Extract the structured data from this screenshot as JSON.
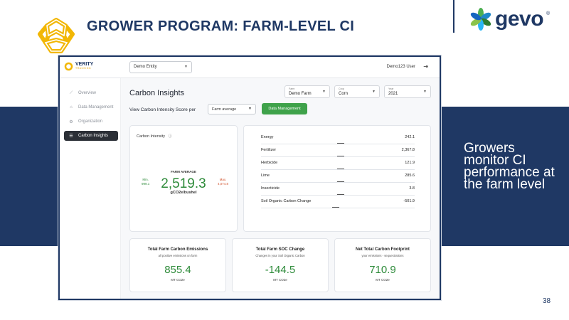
{
  "slide": {
    "title": "GROWER PROGRAM: FARM-LEVEL CI",
    "side_text": "Growers monitor CI performance at the farm level",
    "page_number": "38",
    "logo_word": "gevo",
    "logo_mark": "®"
  },
  "app": {
    "brand": {
      "name": "VERITY",
      "sub": "TRACKING"
    },
    "entity_select": "Demo Entity",
    "user_name": "Demo123 User",
    "sidebar": {
      "items": [
        {
          "label": "Overview",
          "icon": "chart-line-icon"
        },
        {
          "label": "Data Management",
          "icon": "home-icon"
        },
        {
          "label": "Organization",
          "icon": "cog-icon"
        },
        {
          "label": "Carbon Insights",
          "icon": "list-icon",
          "active": true
        }
      ]
    },
    "page_title": "Carbon Insights",
    "filters": [
      {
        "label": "Farm",
        "value": "Demo Farm"
      },
      {
        "label": "Crop",
        "value": "Corn"
      },
      {
        "label": "Year",
        "value": "2021"
      }
    ],
    "ci_score_label": "View Carbon Intensity Score per",
    "ci_score_select": "Farm average",
    "data_management_button": "Data Management",
    "carbon_intensity": {
      "title": "Carbon Intensity",
      "farm_average_label": "FARM AVERAGE",
      "farm_average_value": "2,519.3",
      "unit": "gCO2e/bushel",
      "min_label": "Min.",
      "min_value": "999.1",
      "max_label": "Max.",
      "max_value": "4,074.8"
    },
    "categories": [
      {
        "name": "Energy",
        "value": "242.1"
      },
      {
        "name": "Fertilizer",
        "value": "2,367.8"
      },
      {
        "name": "Herbicide",
        "value": "121.9"
      },
      {
        "name": "Lime",
        "value": "285.6"
      },
      {
        "name": "Insecticide",
        "value": "3.8"
      },
      {
        "name": "Soil Organic Carbon Change",
        "value": "-501.9"
      }
    ],
    "stats": [
      {
        "title": "Total Farm Carbon Emissions",
        "sub": "all positive emissions on farm",
        "value": "855.4",
        "unit": "MT CO2e"
      },
      {
        "title": "Total Farm SOC Change",
        "sub": "Changes in your Soil Organic Carbon",
        "value": "-144.5",
        "unit": "MT CO2e"
      },
      {
        "title": "Net Total Carbon Footprint",
        "sub": "your emissions - sequestrations",
        "value": "710.9",
        "unit": "MT CO2e"
      }
    ]
  },
  "colors": {
    "navy": "#1f3864",
    "green": "#2e8b3a",
    "button_green": "#3fa24a",
    "max_red": "#d0502a",
    "gold": "#f2b705"
  }
}
